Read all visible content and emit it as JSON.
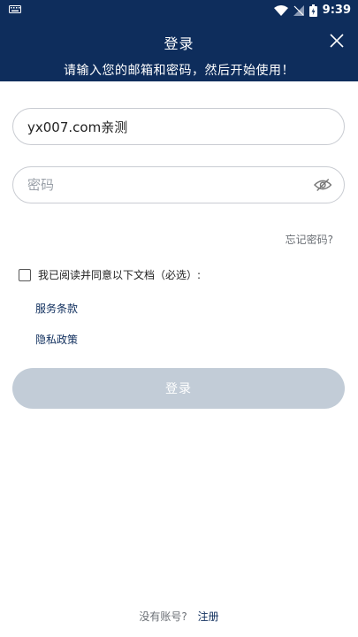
{
  "status_bar": {
    "time": "9:39"
  },
  "header": {
    "title": "登录",
    "subtitle": "请输入您的邮箱和密码，然后开始使用！"
  },
  "form": {
    "email_value": "yx007.com亲测",
    "password_placeholder": "密码",
    "forgot_label": "忘记密码?",
    "agree_label": "我已阅读并同意以下文档（必选）:",
    "terms_link": "服务条款",
    "privacy_link": "隐私政策",
    "login_label": "登录"
  },
  "footer": {
    "no_account": "没有账号?",
    "register": "注册"
  },
  "colors": {
    "header_bg": "#0e2d5c",
    "button_disabled": "#c2ccd7",
    "link": "#0e2d5c"
  }
}
